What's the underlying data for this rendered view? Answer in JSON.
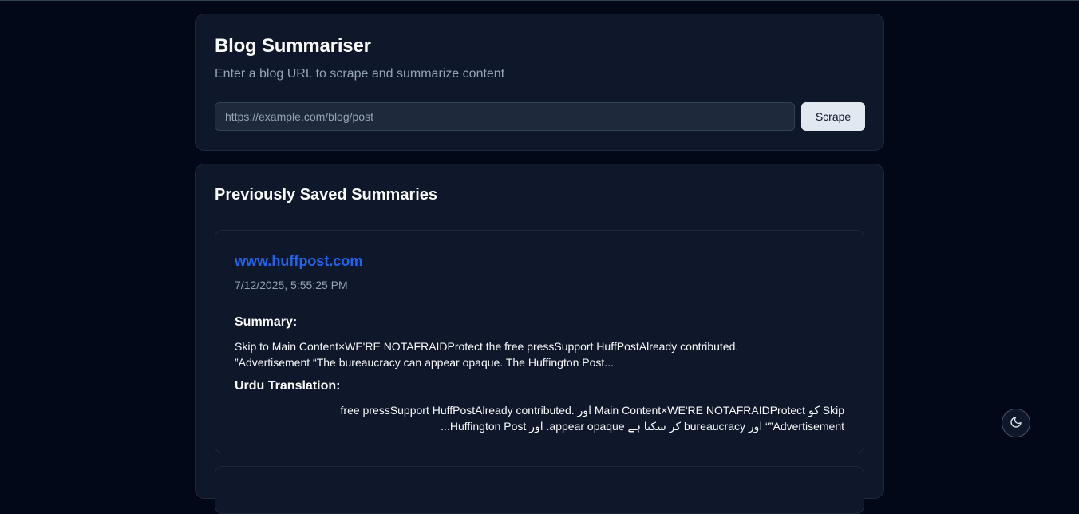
{
  "header": {
    "title": "Blog Summariser",
    "subtitle": "Enter a blog URL to scrape and summarize content"
  },
  "form": {
    "url_placeholder": "https://example.com/blog/post",
    "url_value": "",
    "scrape_label": "Scrape"
  },
  "saved": {
    "title": "Previously Saved Summaries",
    "items": [
      {
        "site": "www.huffpost.com",
        "date": "7/12/2025, 5:55:25 PM",
        "summary_label": "Summary:",
        "summary": "Skip to Main Content×WE'RE NOTAFRAIDProtect the free pressSupport HuffPostAlready contributed. ”Advertisement “The bureaucracy can appear opaque. The Huffington Post...",
        "urdu_label": "Urdu Translation:",
        "urdu": "Skip کو Main Content×WE'RE NOTAFRAIDProtect اور free pressSupport HuffPostAlready contributed. ”Advertisement“ اور bureaucracy کر سکتا ہے appear opaque. اور Huffington Post..."
      }
    ]
  },
  "theme_toggle": {
    "icon": "moon-icon"
  },
  "colors": {
    "background": "#020817",
    "card": "#0f172a",
    "link": "#2563eb",
    "muted": "#94a3b8",
    "button": "#e2e8f0"
  }
}
